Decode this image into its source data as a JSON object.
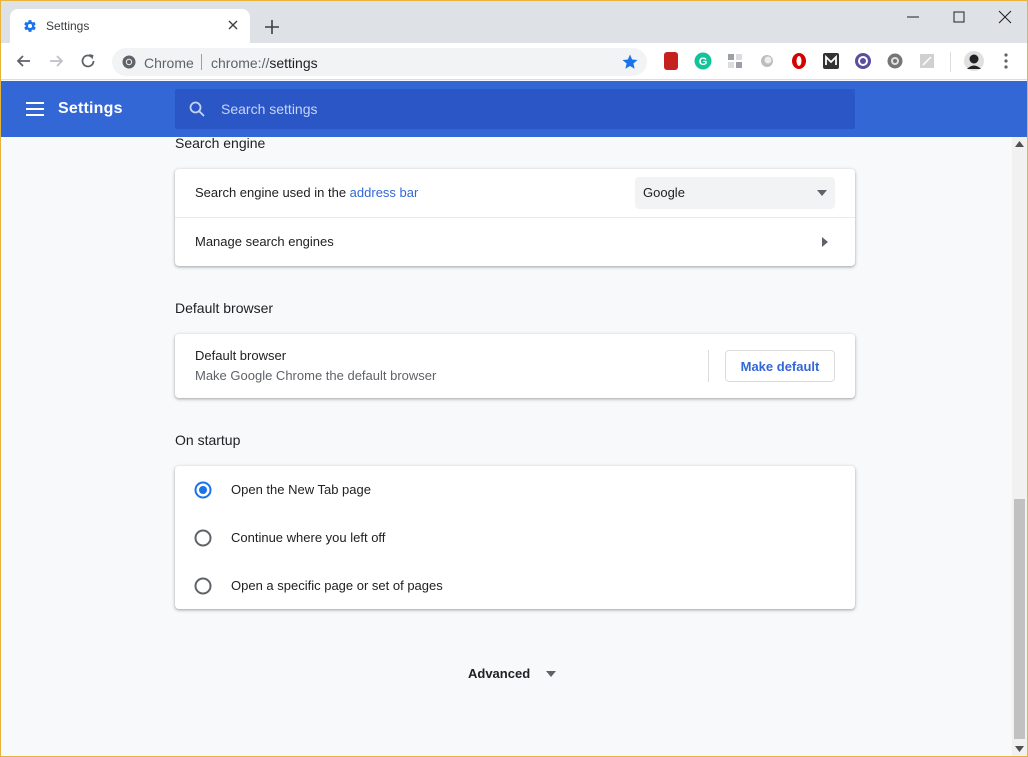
{
  "tab": {
    "title": "Settings",
    "favicon": "gear-icon"
  },
  "omnibox": {
    "site_chip": "Chrome",
    "url_scheme": "chrome://",
    "url_host": "settings"
  },
  "extensions": [
    {
      "name": "book-icon",
      "color": "#c5221f"
    },
    {
      "name": "grammarly-icon",
      "color": "#15c39a"
    },
    {
      "name": "grid-extension-icon",
      "color": "#9aa0a6"
    },
    {
      "name": "circle-extension-icon",
      "color": "#bdbdbd"
    },
    {
      "name": "opera-icon",
      "color": "#d50000"
    },
    {
      "name": "m-extension-icon",
      "color": "#333333"
    },
    {
      "name": "target-extension-icon",
      "color": "#5c4d9e"
    },
    {
      "name": "gear-extension-icon",
      "color": "#757575"
    },
    {
      "name": "pdf-extension-icon",
      "color": "#c8c8c8"
    }
  ],
  "header": {
    "title": "Settings",
    "search_placeholder": "Search settings",
    "color": "#3367d6"
  },
  "search_engine": {
    "section_title": "Search engine",
    "row1_prefix": "Search engine used in the ",
    "row1_link": "address bar",
    "selected_engine": "Google",
    "row2_label": "Manage search engines"
  },
  "default_browser": {
    "section_title": "Default browser",
    "label": "Default browser",
    "sublabel": "Make Google Chrome the default browser",
    "button": "Make default"
  },
  "on_startup": {
    "section_title": "On startup",
    "options": [
      {
        "label": "Open the New Tab page",
        "selected": true
      },
      {
        "label": "Continue where you left off",
        "selected": false
      },
      {
        "label": "Open a specific page or set of pages",
        "selected": false
      }
    ]
  },
  "advanced": {
    "label": "Advanced"
  }
}
